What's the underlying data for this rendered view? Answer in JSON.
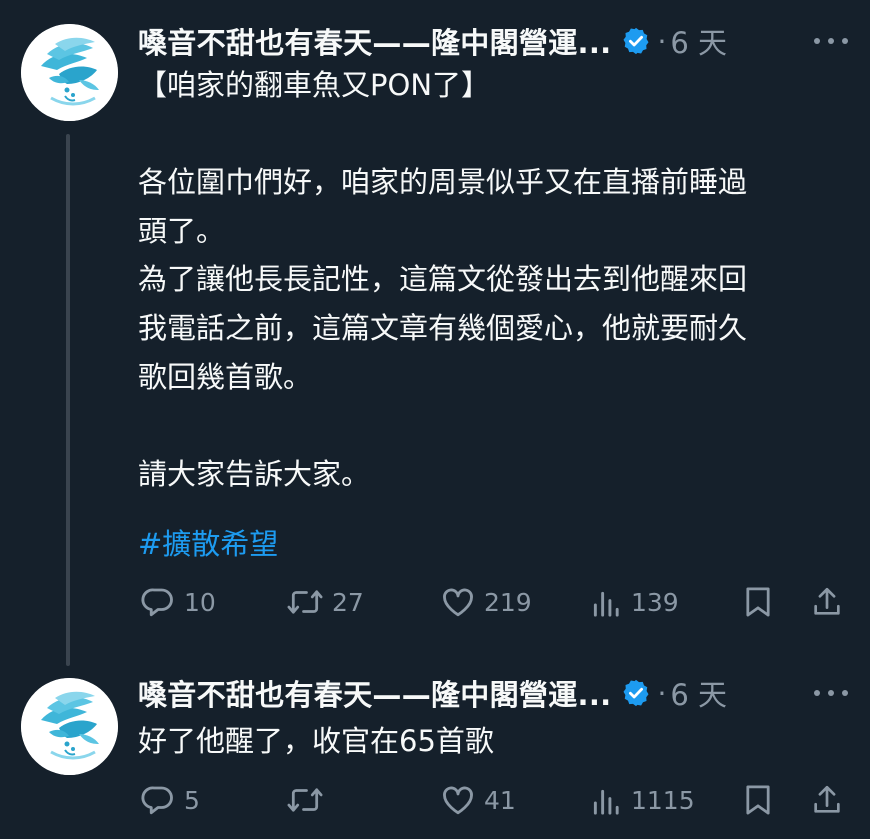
{
  "tweets": [
    {
      "author": {
        "display_name": "嗓音不甜也有春天——隆中閣營運...",
        "verified": true
      },
      "separator": "·",
      "time": "6 天",
      "text": "【咱家的翻車魚又PON了】\n\n各位圍巾們好，咱家的周景似乎又在直播前睡過\n頭了。\n為了讓他長長記性，這篇文從發出去到他醒來回\n我電話之前，這篇文章有幾個愛心，他就要耐久\n歌回幾首歌。\n\n請大家告訴大家。",
      "hashtag": "#擴散希望",
      "stats": {
        "replies": "10",
        "retweets": "27",
        "likes": "219",
        "views": "139"
      }
    },
    {
      "author": {
        "display_name": "嗓音不甜也有春天——隆中閣營運...",
        "verified": true
      },
      "separator": "·",
      "time": "6 天",
      "text": "好了他醒了，收官在65首歌",
      "stats": {
        "replies": "5",
        "retweets": "",
        "likes": "41",
        "views": "1115"
      }
    }
  ],
  "icons": {
    "reply": "reply-icon",
    "retweet": "retweet-icon",
    "like": "heart-icon",
    "views": "views-icon",
    "bookmark": "bookmark-icon",
    "share": "share-icon",
    "more": "more-icon",
    "verified": "verified-badge-icon"
  },
  "colors": {
    "background": "#15202b",
    "text": "#f7f9f9",
    "secondary": "#8b98a5",
    "accent": "#1d9bf0",
    "avatar_brand": "#3fb6d9"
  }
}
